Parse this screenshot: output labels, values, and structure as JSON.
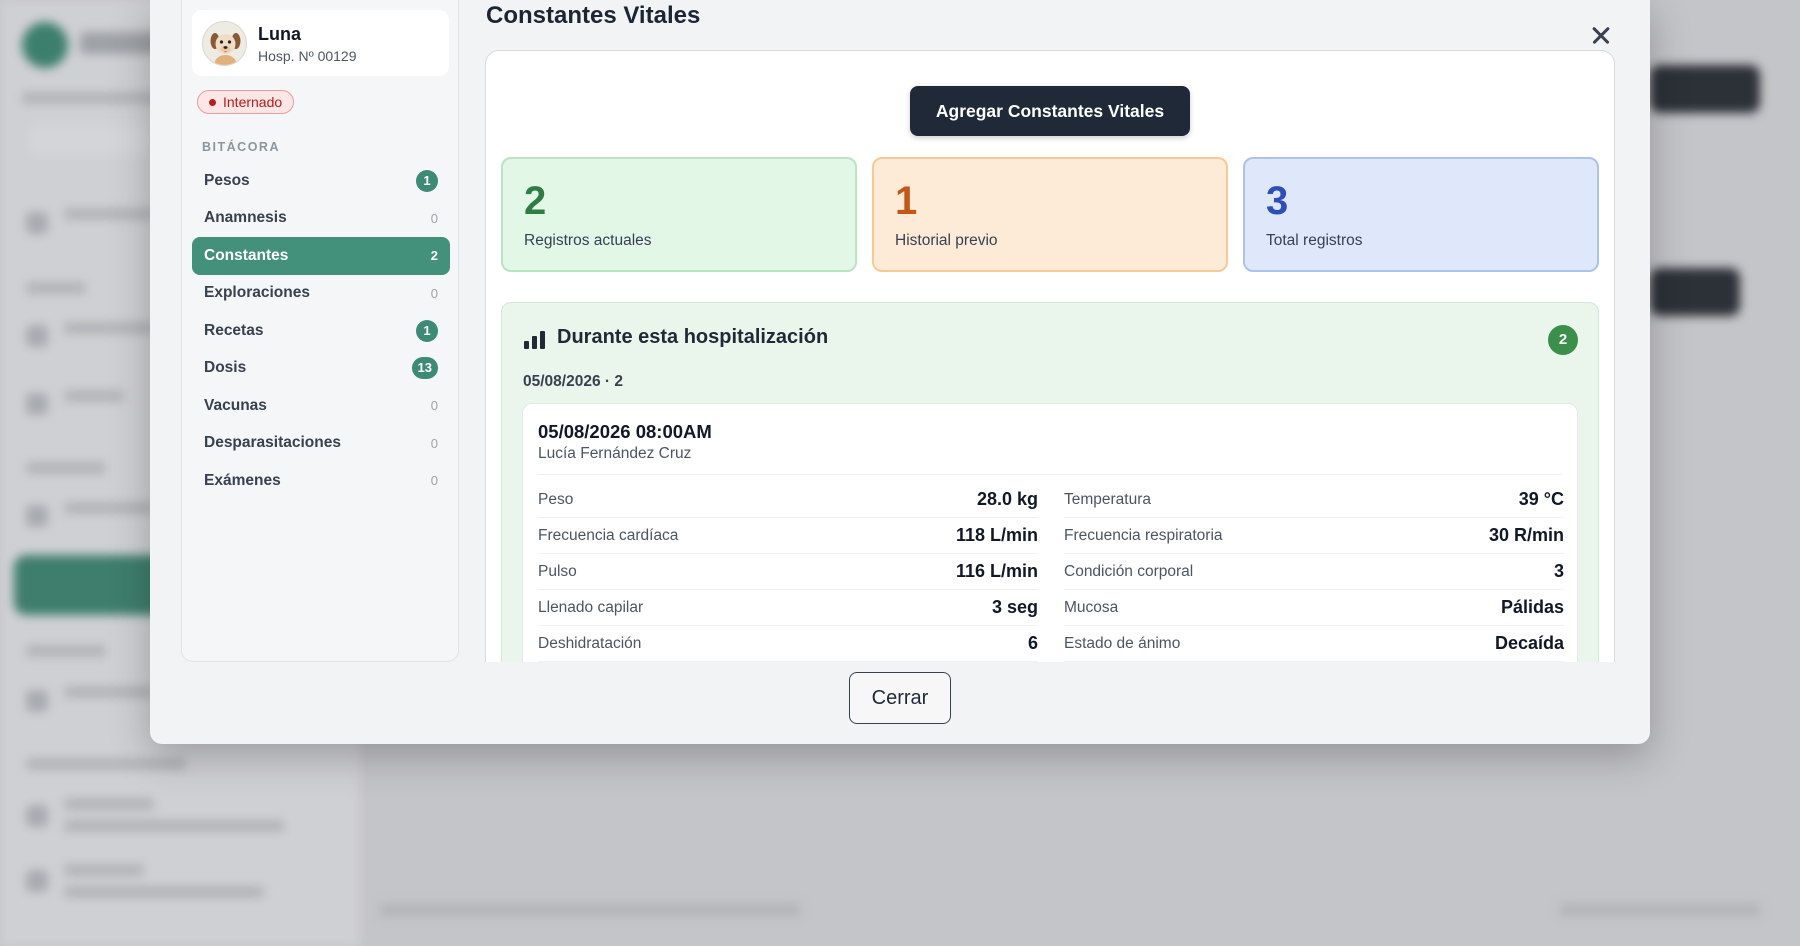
{
  "modal": {
    "title": "Constantes Vitales",
    "close_button": "Cerrar"
  },
  "patient": {
    "name": "Luna",
    "hosp_number": "Hosp. Nº 00129",
    "status": "Internado"
  },
  "sidebar": {
    "section_label": "BITÁCORA",
    "items": [
      {
        "label": "Pesos",
        "count": "1"
      },
      {
        "label": "Anamnesis",
        "count": "0"
      },
      {
        "label": "Constantes",
        "count": "2"
      },
      {
        "label": "Exploraciones",
        "count": "0"
      },
      {
        "label": "Recetas",
        "count": "1"
      },
      {
        "label": "Dosis",
        "count": "13"
      },
      {
        "label": "Vacunas",
        "count": "0"
      },
      {
        "label": "Desparasitaciones",
        "count": "0"
      },
      {
        "label": "Exámenes",
        "count": "0"
      }
    ]
  },
  "main": {
    "add_button": "Agregar Constantes Vitales",
    "stats": [
      {
        "value": "2",
        "label": "Registros actuales"
      },
      {
        "value": "1",
        "label": "Historial previo"
      },
      {
        "value": "3",
        "label": "Total registros"
      }
    ],
    "hospitalization": {
      "title": "Durante esta hospitalización",
      "count": "2",
      "day_label": "05/08/2026 · 2",
      "record": {
        "datetime": "05/08/2026 08:00AM",
        "author": "Lucía Fernández Cruz",
        "vitals_left": [
          {
            "key": "Peso",
            "value": "28.0 kg"
          },
          {
            "key": "Frecuencia cardíaca",
            "value": "118 L/min"
          },
          {
            "key": "Pulso",
            "value": "116 L/min"
          },
          {
            "key": "Llenado capilar",
            "value": "3 seg"
          },
          {
            "key": "Deshidratación",
            "value": "6"
          }
        ],
        "vitals_right": [
          {
            "key": "Temperatura",
            "value": "39 °C"
          },
          {
            "key": "Frecuencia respiratoria",
            "value": "30 R/min"
          },
          {
            "key": "Condición corporal",
            "value": "3"
          },
          {
            "key": "Mucosa",
            "value": "Pálidas"
          },
          {
            "key": "Estado de ánimo",
            "value": "Decaída"
          }
        ]
      }
    }
  },
  "colors": {
    "accent": "#43907b",
    "dark_button": "#1f2937",
    "status_red": "#b91c1c",
    "stat_green": "#2e7d45",
    "stat_orange": "#c2571a",
    "stat_blue": "#2f4fb8"
  }
}
